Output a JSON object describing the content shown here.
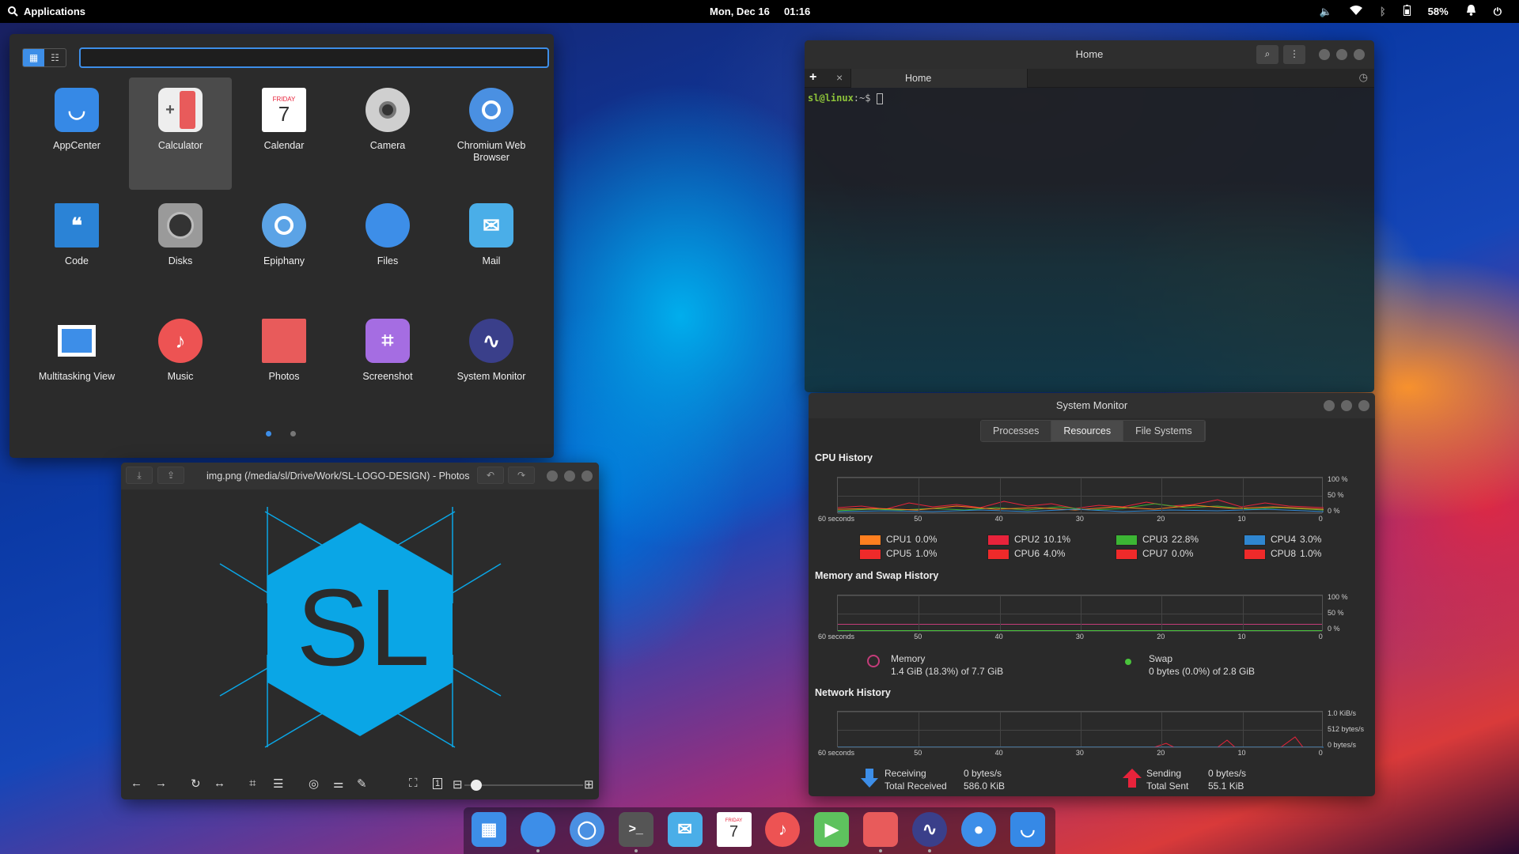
{
  "topbar": {
    "applications_label": "Applications",
    "date": "Mon, Dec 16",
    "time": "01:16",
    "battery": "58%"
  },
  "launcher": {
    "search": {
      "value": "",
      "placeholder": ""
    },
    "apps": [
      {
        "label": "AppCenter",
        "icon": "appcenter-icon",
        "color": "#3689e6"
      },
      {
        "label": "Calculator",
        "icon": "calculator-icon",
        "color": "#eeeeee"
      },
      {
        "label": "Calendar",
        "icon": "calendar-icon",
        "color": "#ffffff",
        "badge": "FRIDAY",
        "day": "7"
      },
      {
        "label": "Camera",
        "icon": "camera-icon",
        "color": "#cfcfcf"
      },
      {
        "label": "Chromium Web\nBrowser",
        "icon": "chromium-icon",
        "color": "#4a90e2"
      },
      {
        "label": "Code",
        "icon": "code-icon",
        "color": "#2b83d6"
      },
      {
        "label": "Disks",
        "icon": "disks-icon",
        "color": "#9a9a9a"
      },
      {
        "label": "Epiphany",
        "icon": "epiphany-icon",
        "color": "#5ba3e6"
      },
      {
        "label": "Files",
        "icon": "files-icon",
        "color": "#3d8ee8"
      },
      {
        "label": "Mail",
        "icon": "mail-icon",
        "color": "#4aaee8"
      },
      {
        "label": "Multitasking View",
        "icon": "multitasking-icon",
        "color": "#3d8ee8"
      },
      {
        "label": "Music",
        "icon": "music-icon",
        "color": "#ed5353"
      },
      {
        "label": "Photos",
        "icon": "photos-icon",
        "color": "#e85b5b"
      },
      {
        "label": "Screenshot",
        "icon": "screenshot-icon",
        "color": "#a56de2"
      },
      {
        "label": "System Monitor",
        "icon": "system-monitor-icon",
        "color": "#3a3f8a"
      }
    ]
  },
  "terminal": {
    "title": "Home",
    "tab_label": "Home",
    "prompt_user": "sl@linux",
    "prompt_rest": ":~$ "
  },
  "photos": {
    "title": "img.png (/media/sl/Drive/Work/SL-LOGO-DESIGN) - Photos",
    "logo_text": "SL",
    "logo_color": "#0aa6e6",
    "zoom": 0.05
  },
  "sysmon": {
    "title": "System Monitor",
    "tabs": [
      "Processes",
      "Resources",
      "File Systems"
    ],
    "cpu_title": "CPU History",
    "mem_title": "Memory and Swap History",
    "net_title": "Network History",
    "x_ticks": [
      "60 seconds",
      "50",
      "40",
      "30",
      "20",
      "10",
      "0"
    ],
    "pct_ticks": [
      "100 %",
      "50 %",
      "0 %"
    ],
    "net_ticks": [
      "1.0 KiB/s",
      "512 bytes/s",
      "0 bytes/s"
    ],
    "cpus": [
      {
        "name": "CPU1",
        "value": "0.0%",
        "color": "#ff7f1f"
      },
      {
        "name": "CPU2",
        "value": "10.1%",
        "color": "#e8233b"
      },
      {
        "name": "CPU3",
        "value": "22.8%",
        "color": "#3cb534"
      },
      {
        "name": "CPU4",
        "value": "3.0%",
        "color": "#2f86d0"
      },
      {
        "name": "CPU5",
        "value": "1.0%",
        "color": "#ef2a2a"
      },
      {
        "name": "CPU6",
        "value": "4.0%",
        "color": "#ef2a2a"
      },
      {
        "name": "CPU7",
        "value": "0.0%",
        "color": "#ef2a2a"
      },
      {
        "name": "CPU8",
        "value": "1.0%",
        "color": "#ef2a2a"
      }
    ],
    "memory": {
      "label": "Memory",
      "value": "1.4 GiB (18.3%) of 7.7 GiB"
    },
    "swap": {
      "label": "Swap",
      "value": "0 bytes (0.0%) of 2.8 GiB"
    },
    "receiving": {
      "label": "Receiving",
      "value": "0 bytes/s",
      "total_label": "Total Received",
      "total": "586.0 KiB"
    },
    "sending": {
      "label": "Sending",
      "value": "0 bytes/s",
      "total_label": "Total Sent",
      "total": "55.1 KiB"
    }
  },
  "dock": {
    "items": [
      {
        "icon": "multitasking-icon",
        "color": "#3d8ee8"
      },
      {
        "icon": "files-icon",
        "color": "#3d8ee8"
      },
      {
        "icon": "chromium-icon",
        "color": "#4a90e2"
      },
      {
        "icon": "terminal-icon",
        "color": "#555555"
      },
      {
        "icon": "mail-icon",
        "color": "#4aaee8"
      },
      {
        "icon": "calendar-icon",
        "color": "#ffffff",
        "badge": "FRIDAY",
        "day": "7"
      },
      {
        "icon": "music-icon",
        "color": "#ed5353"
      },
      {
        "icon": "videos-icon",
        "color": "#5ec25e"
      },
      {
        "icon": "photos-icon",
        "color": "#e85b5b"
      },
      {
        "icon": "system-monitor-icon",
        "color": "#3a3f8a"
      },
      {
        "icon": "settings-icon",
        "color": "#3d8ee8"
      },
      {
        "icon": "appcenter-icon",
        "color": "#3689e6"
      }
    ]
  }
}
